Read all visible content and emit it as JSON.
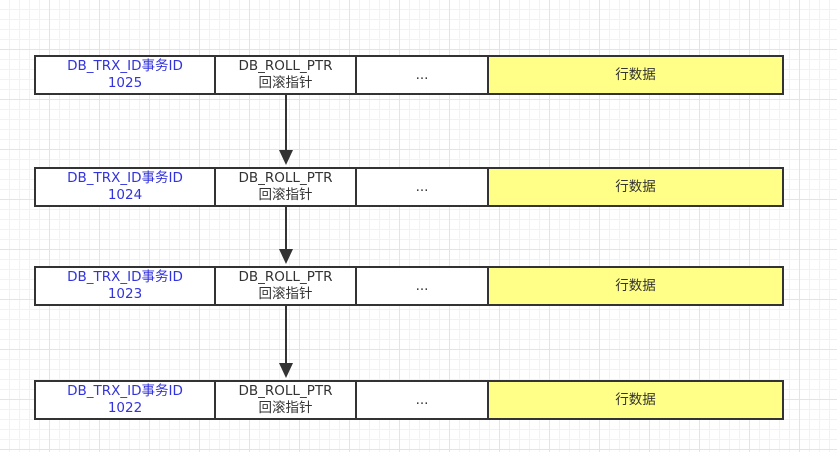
{
  "colors": {
    "data_fill": "#ffff88",
    "id_text": "#3333dd",
    "line": "#333333"
  },
  "rows": [
    {
      "trx_label": "DB_TRX_ID事务ID",
      "trx_value": "1025",
      "ptr_label": "DB_ROLL_PTR",
      "ptr_desc": "回滚指针",
      "more": "...",
      "data": "行数据"
    },
    {
      "trx_label": "DB_TRX_ID事务ID",
      "trx_value": "1024",
      "ptr_label": "DB_ROLL_PTR",
      "ptr_desc": "回滚指针",
      "more": "...",
      "data": "行数据"
    },
    {
      "trx_label": "DB_TRX_ID事务ID",
      "trx_value": "1023",
      "ptr_label": "DB_ROLL_PTR",
      "ptr_desc": "回滚指针",
      "more": "...",
      "data": "行数据"
    },
    {
      "trx_label": "DB_TRX_ID事务ID",
      "trx_value": "1022",
      "ptr_label": "DB_ROLL_PTR",
      "ptr_desc": "回滚指针",
      "more": "...",
      "data": "行数据"
    }
  ]
}
